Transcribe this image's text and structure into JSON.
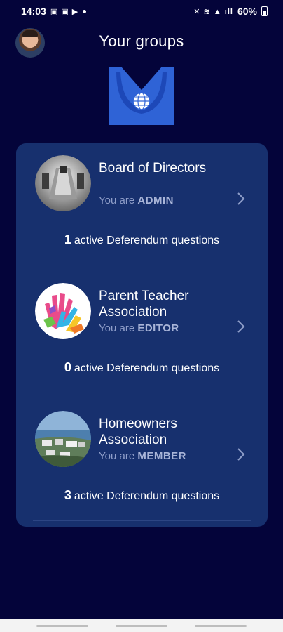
{
  "status_bar": {
    "time": "14:03",
    "battery": "60%",
    "left_glyphs": "▣ ▣ ▶",
    "right_glyphs": "✕ ≋ ▲ ıll"
  },
  "header": {
    "title": "Your groups",
    "avatar_icon": "user-avatar",
    "logo_icon": "deferendum-logo"
  },
  "colors": {
    "background": "#04043a",
    "card": "#17306e",
    "role_text": "#8f9ec9",
    "logo_blue": "#2f63d6"
  },
  "groups": [
    {
      "name": "Board of Directors",
      "role_prefix": "You are",
      "role": "ADMIN",
      "active_count": "1",
      "active_text": "active Deferendum questions",
      "photo_icon": "boardroom-photo"
    },
    {
      "name": "Parent Teacher Association",
      "role_prefix": "You are",
      "role": "EDITOR",
      "active_count": "0",
      "active_text": "active Deferendum questions",
      "photo_icon": "colorful-hands-photo"
    },
    {
      "name": "Homeowners Association",
      "role_prefix": "You are",
      "role": "MEMBER",
      "active_count": "3",
      "active_text": "active Deferendum questions",
      "photo_icon": "coastal-town-photo"
    }
  ]
}
